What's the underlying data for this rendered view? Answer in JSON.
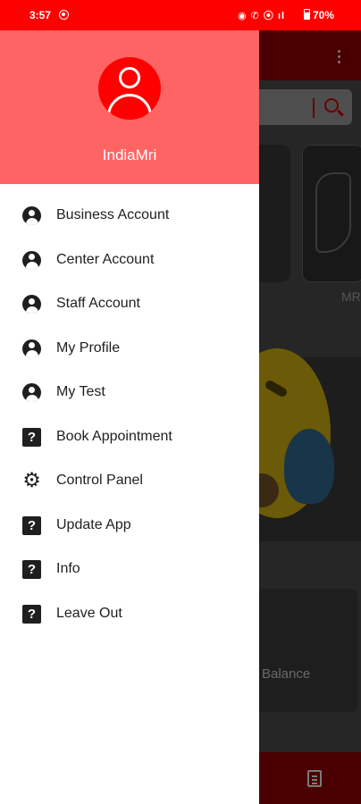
{
  "status_bar": {
    "time": "3:57",
    "battery": "70%",
    "icons": "◉ ✆ ⦿ ıl"
  },
  "drawer": {
    "user_name": "IndiaMri",
    "items": [
      {
        "label": "Business Account",
        "icon": "account-circle-icon"
      },
      {
        "label": "Center Account",
        "icon": "account-circle-icon"
      },
      {
        "label": "Staff Account",
        "icon": "account-circle-icon"
      },
      {
        "label": "My Profile",
        "icon": "account-circle-icon"
      },
      {
        "label": "My Test",
        "icon": "account-circle-icon"
      },
      {
        "label": "Book Appointment",
        "icon": "help-icon"
      },
      {
        "label": "Control Panel",
        "icon": "gear-icon"
      },
      {
        "label": "Update App",
        "icon": "help-icon"
      },
      {
        "label": "Info",
        "icon": "help-icon"
      },
      {
        "label": "Leave Out",
        "icon": "help-icon"
      }
    ]
  },
  "background": {
    "card_label": "MR",
    "balance_label": "Balance"
  },
  "colors": {
    "status_bar": "#ff0000",
    "drawer_header": "#ff6464",
    "avatar": "#ff0000"
  }
}
